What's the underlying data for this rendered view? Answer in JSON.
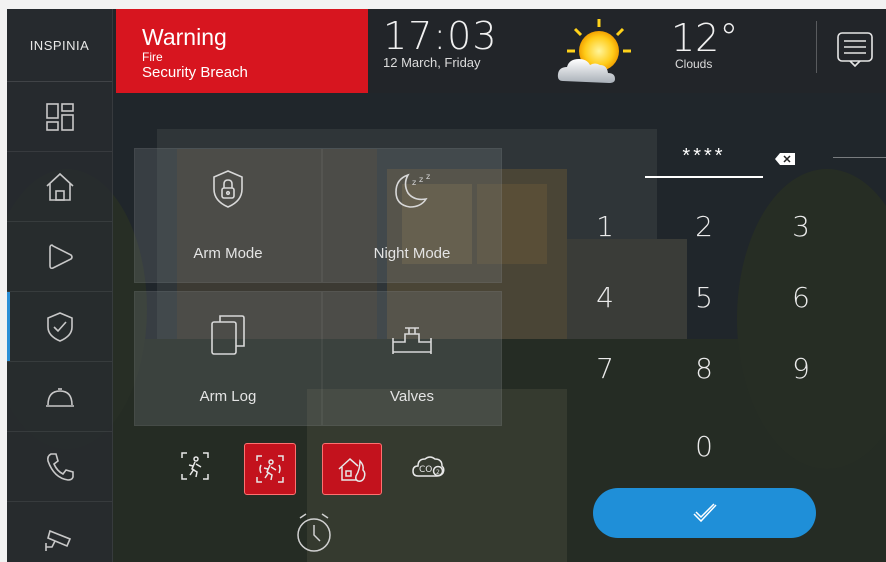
{
  "brand": {
    "logo_text": "INSPINIA"
  },
  "sidebar": {
    "items": [
      {
        "name": "dashboard",
        "icon": "dashboard-icon"
      },
      {
        "name": "home",
        "icon": "home-icon"
      },
      {
        "name": "scenes",
        "icon": "play-icon"
      },
      {
        "name": "security",
        "icon": "shield-check-icon",
        "active": true
      },
      {
        "name": "services",
        "icon": "cloche-icon"
      },
      {
        "name": "phone",
        "icon": "phone-icon"
      },
      {
        "name": "camera",
        "icon": "cctv-camera-icon"
      }
    ]
  },
  "alert": {
    "title": "Warning",
    "subtitle": "Fire",
    "message": "Security Breach",
    "color": "#d7151f"
  },
  "clock": {
    "time": "17:03",
    "date": "12 March, Friday"
  },
  "weather": {
    "temperature": "12°",
    "condition": "Clouds",
    "icon": "sun-behind-cloud-icon"
  },
  "modes": [
    {
      "label": "Arm Mode",
      "icon": "lock-icon"
    },
    {
      "label": "Night Mode",
      "icon": "moon-zzz-icon"
    },
    {
      "label": "Arm Log",
      "icon": "documents-icon"
    },
    {
      "label": "Valves",
      "icon": "valve-icon"
    }
  ],
  "sensors": [
    {
      "name": "motion",
      "icon": "motion-sensor-icon",
      "alert": false
    },
    {
      "name": "motion-alarm",
      "icon": "motion-sensor-icon",
      "alert": true
    },
    {
      "name": "fire",
      "icon": "house-fire-icon",
      "alert": true
    },
    {
      "name": "co2",
      "icon": "co2-cloud-icon",
      "alert": false,
      "label": "CO2"
    }
  ],
  "keypad": {
    "pin_masked": "****",
    "keys": [
      "1",
      "2",
      "3",
      "4",
      "5",
      "6",
      "7",
      "8",
      "9",
      "0"
    ],
    "accent": "#1f8fd8"
  }
}
